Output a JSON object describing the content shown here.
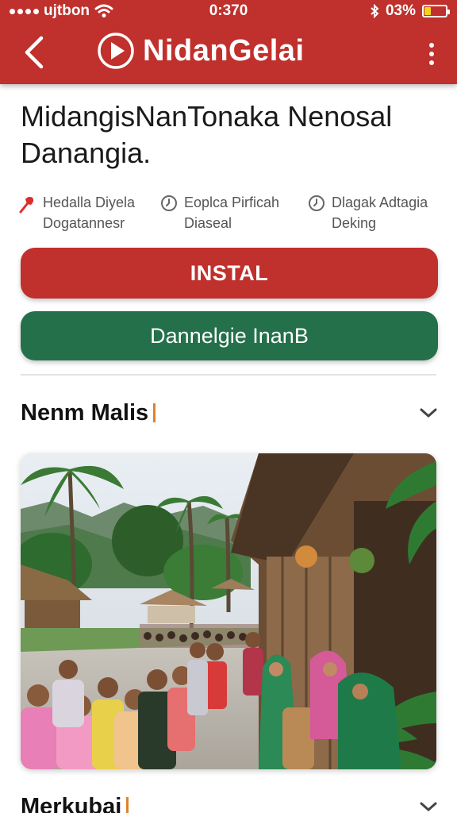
{
  "status_bar": {
    "carrier": "ujtbon",
    "time": "0:370",
    "battery": "03%",
    "battery_level": 0.3
  },
  "header": {
    "app_name": "NidanGelai",
    "colors": {
      "bar": "#c0302c",
      "text": "#ffffff"
    }
  },
  "title": {
    "line1": "MidangisNanTonaka Nenosal",
    "line2": "Danangia."
  },
  "meta": [
    {
      "icon": "pin-icon",
      "line1": "Hedalla Diyela",
      "line2": "Dogatannesr"
    },
    {
      "icon": "clock-icon",
      "line1": "Eoplca Pirficah",
      "line2": "Diaseal"
    },
    {
      "icon": "clock-icon",
      "line1": "Dlagak Adtagia",
      "line2": "Deking"
    }
  ],
  "buttons": {
    "install": {
      "label": "INSTAL",
      "color": "#c0302c"
    },
    "secondary": {
      "label": "Dannelgie InanB",
      "color": "#23704a"
    }
  },
  "sections": [
    {
      "title": "Nenm Malis"
    },
    {
      "title": "Merkubai"
    }
  ],
  "hero_image": {
    "icon": "village-market-photo"
  }
}
